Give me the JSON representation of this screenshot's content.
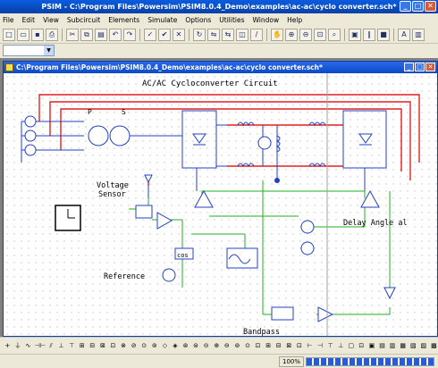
{
  "window": {
    "title": "PSIM - C:\\Program Files\\Powersim\\PSIM8.0.4_Demo\\examples\\ac-ac\\cyclo converter.sch*"
  },
  "menu": [
    "File",
    "Edit",
    "View",
    "Subcircuit",
    "Elements",
    "Simulate",
    "Options",
    "Utilities",
    "Window",
    "Help"
  ],
  "toolbar_icons": [
    "new-icon",
    "open-icon",
    "save-icon",
    "print-icon",
    "cut-icon",
    "copy-icon",
    "paste-icon",
    "undo-icon",
    "redo-icon",
    "check-icon",
    "run-icon",
    "cancel-icon",
    "rotate-icon",
    "flip-icon",
    "mirror-icon",
    "label-icon",
    "wire-icon",
    "hand-icon",
    "zoom-in-icon",
    "zoom-out-icon",
    "fit-icon",
    "zoom-select-icon",
    "simview-icon",
    "pause-icon",
    "stop-icon",
    "text-icon",
    "element-icon"
  ],
  "toolbar_glyphs": [
    "□",
    "▭",
    "▪",
    "⎙",
    "✂",
    "⧉",
    "▤",
    "↶",
    "↷",
    "✓",
    "✔",
    "✕",
    "↻",
    "⇋",
    "⇆",
    "◫",
    "/",
    "✋",
    "⊕",
    "⊖",
    "⊡",
    "⌕",
    "▣",
    "∥",
    "■",
    "A",
    "▥"
  ],
  "child_window": {
    "title": "C:\\Program Files\\Powersim\\PSIM8.0.4_Demo\\examples\\ac-ac\\cyclo converter.sch*"
  },
  "schematic": {
    "title": "AC/AC Cycloconverter Circuit",
    "labels": {
      "p": "P",
      "s": "S",
      "voltage": "Voltage",
      "sensor": "Sensor",
      "delay": "Delay Angle al",
      "reference": "Reference",
      "cos": "cos",
      "bandpass": "Bandpass"
    }
  },
  "element_bar_glyphs": [
    "+",
    "⏚",
    "∿",
    "⊣⊢",
    "⫽",
    "⊥",
    "⊤",
    "⊞",
    "⊟",
    "⊠",
    "⊡",
    "⊗",
    "⊘",
    "⊙",
    "⊚",
    "◇",
    "◈",
    "⊛",
    "⊜",
    "⊝",
    "⊕",
    "⊖",
    "⊚",
    "⊙",
    "⊡",
    "⊞",
    "⊟",
    "⊠",
    "⊡",
    "⊢",
    "⊣",
    "⊤",
    "⊥",
    "▢",
    "⊡",
    "▣",
    "▤",
    "▥",
    "▦",
    "▧",
    "▨",
    "▩"
  ],
  "status": {
    "zoom": "100%",
    "progress": 1.0
  }
}
